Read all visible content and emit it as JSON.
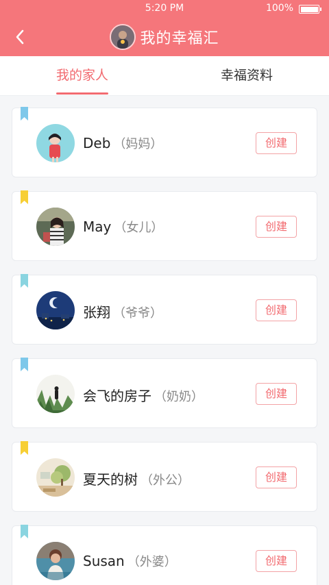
{
  "status_bar": {
    "time": "5:20 PM",
    "battery": "100%"
  },
  "header": {
    "title": "我的幸福汇"
  },
  "tabs": [
    {
      "label": "我的家人",
      "active": true
    },
    {
      "label": "幸福资料",
      "active": false
    }
  ],
  "colors": {
    "primary": "#f5767b",
    "accent": "#f26b70",
    "ribbon_blue": "#7ec8ea",
    "ribbon_yellow": "#f7cf35",
    "ribbon_teal": "#8ad4e0"
  },
  "family": [
    {
      "name": "Deb",
      "relation": "（妈妈）",
      "button": "创建",
      "ribbon": "blue"
    },
    {
      "name": "May",
      "relation": "（女儿）",
      "button": "创建",
      "ribbon": "yellow"
    },
    {
      "name": "张翔",
      "relation": "（爷爷）",
      "button": "创建",
      "ribbon": "teal"
    },
    {
      "name": "会飞的房子",
      "relation": "（奶奶）",
      "button": "创建",
      "ribbon": "blue"
    },
    {
      "name": "夏天的树",
      "relation": "（外公）",
      "button": "创建",
      "ribbon": "yellow"
    },
    {
      "name": "Susan",
      "relation": "（外婆）",
      "button": "创建",
      "ribbon": "teal"
    }
  ]
}
